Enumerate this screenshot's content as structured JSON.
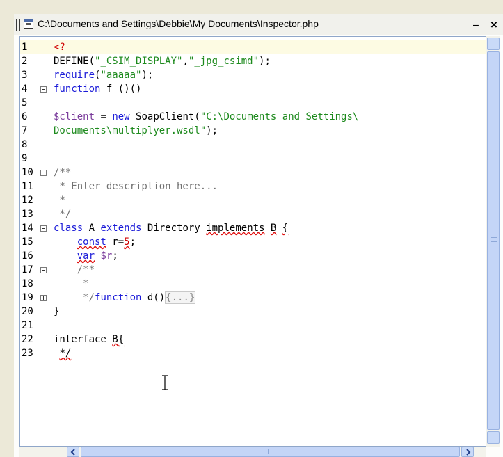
{
  "window": {
    "title": "C:\\Documents and Settings\\Debbie\\My Documents\\Inspector.php",
    "minimize_glyph": "–",
    "close_glyph": "×"
  },
  "editor": {
    "current_line": 1,
    "line_numbers": [
      "1",
      "2",
      "3",
      "4",
      "5",
      "6",
      "7",
      "8",
      "9",
      "10",
      "11",
      "12",
      "13",
      "14",
      "15",
      "16",
      "17",
      "18",
      "19",
      "20",
      "21",
      "22",
      "23"
    ],
    "code": {
      "l1_tag": "<?",
      "l2_a": "DEFINE(",
      "l2_b": "\"_CSIM_DISPLAY\"",
      "l2_c": ",",
      "l2_d": "\"_jpg_csimd\"",
      "l2_e": ");",
      "l3_a": "require",
      "l3_b": "(",
      "l3_c": "\"aaaaa\"",
      "l3_d": ");",
      "l4_a": "function",
      "l4_b": " f ()()",
      "l6_a": "$client",
      "l6_b": " = ",
      "l6_c": "new",
      "l6_d": " SoapClient(",
      "l6_e": "\"C:\\Documents and Settings\\",
      "l7_a": "Documents\\multiplyer.wsdl\"",
      "l7_b": ");",
      "l10": "/**",
      "l11": " * Enter description here...",
      "l12": " *",
      "l13": " */",
      "l14_a": "class",
      "l14_b": " A ",
      "l14_c": "extends",
      "l14_d": " Directory ",
      "l14_e": "implements",
      "l14_f": " ",
      "l14_g": "B",
      "l14_h": " ",
      "l14_i": "{",
      "l15_a": "    ",
      "l15_b": "const",
      "l15_c": " r=",
      "l15_d": "5",
      "l15_e": ";",
      "l16_a": "    ",
      "l16_b": "var",
      "l16_c": " ",
      "l16_d": "$r",
      "l16_e": ";",
      "l17": "    /**",
      "l18": "     *",
      "l19_a": "     */",
      "l19_b": "function",
      "l19_c": " d()",
      "l19_d": "{...}",
      "l20": "}",
      "l22_a": "interface ",
      "l22_b": "B",
      "l22_c": "{",
      "l23_a": " ",
      "l23_b": "*/"
    }
  },
  "colors": {
    "keyword": "#1b1bd8",
    "string": "#1d8a1d",
    "variable": "#7a3b9b",
    "comment": "#707070",
    "php_tag": "#d00000",
    "current_line_bg": "#fdfbe3",
    "scrollbar": "#c4d5f7"
  },
  "icons": {
    "document": "document-icon",
    "ibeam": "text-cursor-ibeam-icon",
    "scroll_up": "chevron-up-icon",
    "scroll_down": "chevron-down-icon",
    "scroll_left": "chevron-left-icon",
    "scroll_right": "chevron-right-icon",
    "fold_collapse": "fold-minus-icon",
    "fold_expand": "fold-plus-icon"
  }
}
